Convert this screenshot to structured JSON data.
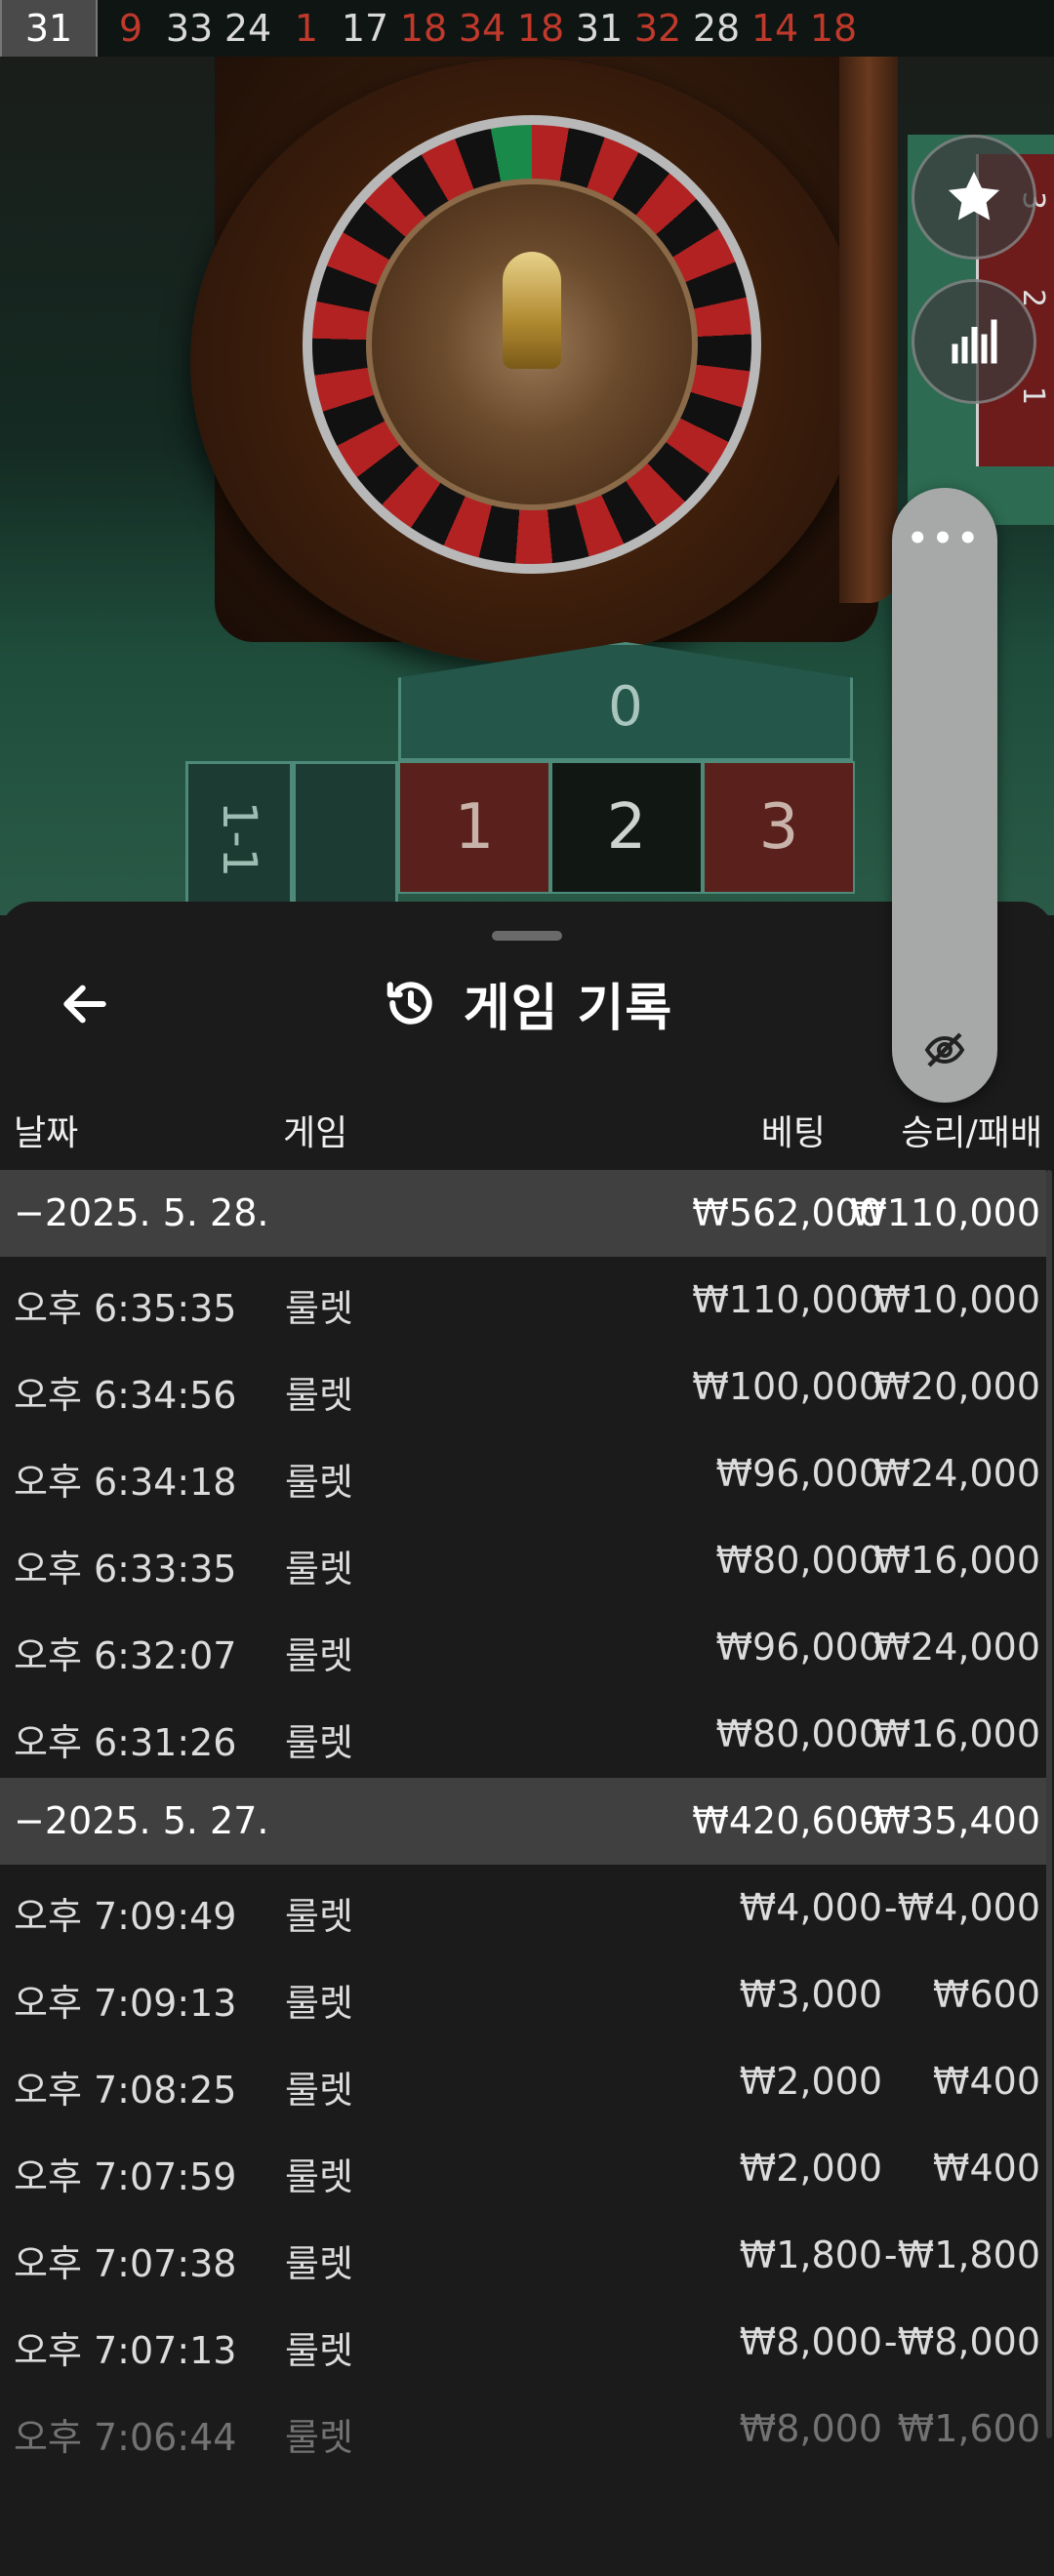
{
  "results_bar": {
    "numbers": [
      {
        "value": "31",
        "color": "highlight"
      },
      {
        "value": "9",
        "color": "red"
      },
      {
        "value": "33",
        "color": "black"
      },
      {
        "value": "24",
        "color": "black"
      },
      {
        "value": "1",
        "color": "red"
      },
      {
        "value": "17",
        "color": "black"
      },
      {
        "value": "18",
        "color": "red"
      },
      {
        "value": "34",
        "color": "red"
      },
      {
        "value": "18",
        "color": "red"
      },
      {
        "value": "31",
        "color": "black"
      },
      {
        "value": "32",
        "color": "red"
      },
      {
        "value": "28",
        "color": "black"
      },
      {
        "value": "14",
        "color": "red"
      },
      {
        "value": "18",
        "color": "red"
      }
    ]
  },
  "table": {
    "zero": "0",
    "left_label": "1-1",
    "cells": [
      {
        "value": "1",
        "color": "red"
      },
      {
        "value": "2",
        "color": "black"
      },
      {
        "value": "3",
        "color": "red"
      }
    ],
    "side_numbers": [
      "3",
      "2",
      "1"
    ]
  },
  "floating": {
    "favorite_icon": "star-icon",
    "stats_icon": "bar-chart-icon",
    "menu_icon": "more-dots-icon",
    "menu_dots": "•••",
    "hide_icon": "eye-off-icon"
  },
  "history": {
    "back_icon": "arrow-left-icon",
    "title": "게임 기록",
    "columns": {
      "date": "날짜",
      "game": "게임",
      "bet": "베팅",
      "win": "승리/패배"
    },
    "rows": [
      {
        "type": "group",
        "date": "−2025. 5. 28.",
        "game": "",
        "bet": "₩562,000",
        "win": "₩110,000"
      },
      {
        "type": "item",
        "date": "오후 6:35:35",
        "game": "룰렛",
        "bet": "₩110,000",
        "win": "₩10,000"
      },
      {
        "type": "item",
        "date": "오후 6:34:56",
        "game": "룰렛",
        "bet": "₩100,000",
        "win": "₩20,000"
      },
      {
        "type": "item",
        "date": "오후 6:34:18",
        "game": "룰렛",
        "bet": "₩96,000",
        "win": "₩24,000"
      },
      {
        "type": "item",
        "date": "오후 6:33:35",
        "game": "룰렛",
        "bet": "₩80,000",
        "win": "₩16,000"
      },
      {
        "type": "item",
        "date": "오후 6:32:07",
        "game": "룰렛",
        "bet": "₩96,000",
        "win": "₩24,000"
      },
      {
        "type": "item",
        "date": "오후 6:31:26",
        "game": "룰렛",
        "bet": "₩80,000",
        "win": "₩16,000"
      },
      {
        "type": "group",
        "date": "−2025. 5. 27.",
        "game": "",
        "bet": "₩420,600",
        "win": "-₩35,400"
      },
      {
        "type": "item",
        "date": "오후 7:09:49",
        "game": "룰렛",
        "bet": "₩4,000",
        "win": "-₩4,000"
      },
      {
        "type": "item",
        "date": "오후 7:09:13",
        "game": "룰렛",
        "bet": "₩3,000",
        "win": "₩600"
      },
      {
        "type": "item",
        "date": "오후 7:08:25",
        "game": "룰렛",
        "bet": "₩2,000",
        "win": "₩400"
      },
      {
        "type": "item",
        "date": "오후 7:07:59",
        "game": "룰렛",
        "bet": "₩2,000",
        "win": "₩400"
      },
      {
        "type": "item",
        "date": "오후 7:07:38",
        "game": "룰렛",
        "bet": "₩1,800",
        "win": "-₩1,800"
      },
      {
        "type": "item",
        "date": "오후 7:07:13",
        "game": "룰렛",
        "bet": "₩8,000",
        "win": "-₩8,000"
      },
      {
        "type": "item",
        "date": "오후 7:06:44",
        "game": "룰렛",
        "bet": "₩8,000",
        "win": "₩1,600",
        "faded": true
      }
    ]
  }
}
